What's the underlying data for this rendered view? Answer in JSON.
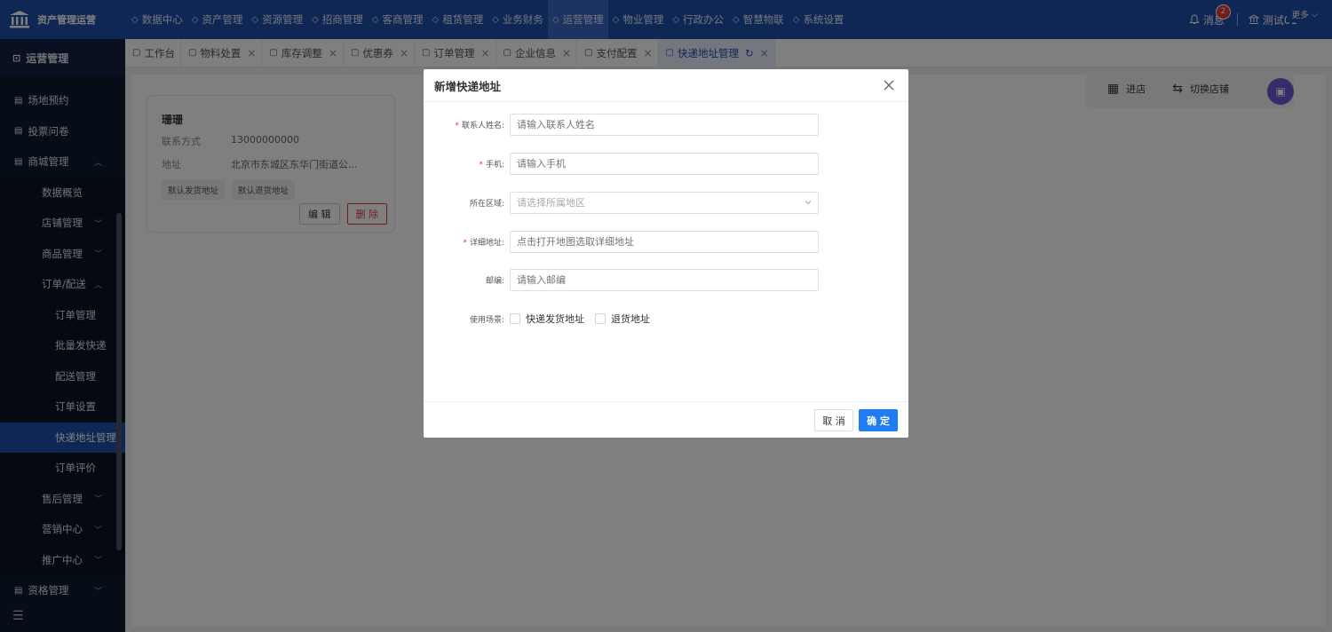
{
  "brand": {
    "title": "资产管理运营",
    "logo_icon": "bank-icon"
  },
  "nav": [
    {
      "label": "数据中心",
      "icon": "monitor-icon"
    },
    {
      "label": "资产管理",
      "icon": "cube-icon"
    },
    {
      "label": "资源管理",
      "icon": "building-icon"
    },
    {
      "label": "招商管理",
      "icon": "tag-icon"
    },
    {
      "label": "客商管理",
      "icon": "users-icon"
    },
    {
      "label": "租赁管理",
      "icon": "home-icon"
    },
    {
      "label": "业务财务",
      "icon": "coin-icon"
    },
    {
      "label": "运营管理",
      "icon": "ops-icon"
    },
    {
      "label": "物业管理",
      "icon": "property-icon"
    },
    {
      "label": "行政办公",
      "icon": "desk-icon"
    },
    {
      "label": "智慧物联",
      "icon": "iot-icon"
    },
    {
      "label": "系统设置",
      "icon": "gear-icon"
    }
  ],
  "top_right": {
    "messages_label": "消息",
    "messages_count": "2",
    "user_label": "测试01"
  },
  "sidebar": {
    "title": "运营管理",
    "items": [
      {
        "label": "场地预约",
        "level": 1
      },
      {
        "label": "投票问卷",
        "level": 1
      },
      {
        "label": "商城管理",
        "level": 1,
        "open": true
      },
      {
        "label": "数据概览",
        "level": 2
      },
      {
        "label": "店铺管理",
        "level": 2
      },
      {
        "label": "商品管理",
        "level": 2
      },
      {
        "label": "订单/配送",
        "level": 2,
        "open": true
      },
      {
        "label": "订单管理",
        "level": 3
      },
      {
        "label": "批量发快递",
        "level": 3
      },
      {
        "label": "配送管理",
        "level": 3
      },
      {
        "label": "订单设置",
        "level": 3
      },
      {
        "label": "快递地址管理",
        "level": 3,
        "active": true
      },
      {
        "label": "订单评价",
        "level": 3
      },
      {
        "label": "售后管理",
        "level": 2
      },
      {
        "label": "营销中心",
        "level": 2
      },
      {
        "label": "推广中心",
        "level": 2
      },
      {
        "label": "资格管理",
        "level": 1
      }
    ]
  },
  "tabs": [
    {
      "label": "工作台"
    },
    {
      "label": "物料处置"
    },
    {
      "label": "库存调整"
    },
    {
      "label": "优惠券"
    },
    {
      "label": "订单管理"
    },
    {
      "label": "企业信息"
    },
    {
      "label": "支付配置"
    },
    {
      "label": "快递地址管理",
      "active": true
    }
  ],
  "more_label": "更多",
  "card": {
    "name": "珊珊",
    "contact_label": "联系方式",
    "contact_value": "13000000000",
    "address_label": "地址",
    "address_value": "北京市东城区东华门街道公...",
    "tag1": "默认发货地址",
    "tag2": "默认退货地址",
    "edit_label": "编 辑",
    "delete_label": "删 除"
  },
  "store_bar": {
    "enter_label": "进店",
    "switch_label": "切换店铺"
  },
  "dialog": {
    "title": "新增快递地址",
    "fields": {
      "name": {
        "label": "联系人姓名:",
        "placeholder": "请输入联系人姓名"
      },
      "phone": {
        "label": "手机:",
        "placeholder": "请输入手机"
      },
      "region": {
        "label": "所在区域:",
        "placeholder": "请选择所属地区"
      },
      "detail": {
        "label": "详细地址:",
        "placeholder": "点击打开地图选取详细地址"
      },
      "zip": {
        "label": "邮编:",
        "placeholder": "请输入邮编"
      }
    },
    "scene_label": "使用场景:",
    "scene_options": [
      "快递发货地址",
      "退货地址"
    ],
    "cancel_label": "取 消",
    "ok_label": "确 定"
  }
}
